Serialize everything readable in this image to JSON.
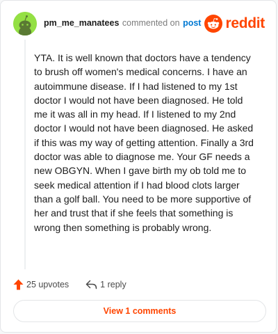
{
  "comment": {
    "author": "pm_me_manatees",
    "action": "commented on",
    "target": "post",
    "body": "YTA. It is well known that doctors have a tendency to brush off women's medical concerns. I have an autoimmune disease. If I had listened to my 1st doctor I would not have been diagnosed. He told me it was all in my head. If I listened to my 2nd doctor I would not have been diagnosed. He asked if this was my way of getting attention. Finally a 3rd doctor was able to diagnose me. Your GF needs a new OBGYN. When I gave birth my ob told me to seek medical attention if I had blood clots larger than a golf ball. You need to be more supportive of her and trust that if she feels that something is wrong then something is probably wrong."
  },
  "brand": {
    "name": "reddit",
    "icon": "reddit-snoo-icon",
    "color": "#ff4500"
  },
  "actions": {
    "upvotes_label": "25 upvotes",
    "upvote_icon": "upvote-arrow-icon",
    "reply_label": "1 reply",
    "reply_icon": "reply-arrow-icon"
  },
  "view_comments_label": "View 1 comments",
  "colors": {
    "accent": "#ff4500",
    "link": "#0079d3",
    "avatar_bg": "#94e044"
  }
}
